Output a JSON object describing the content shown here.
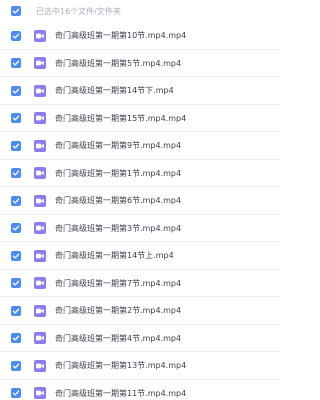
{
  "header": {
    "selection_text": "已选中16个文件/文件夹"
  },
  "files": [
    {
      "name": "奇门高级班第一期第10节.mp4.mp4"
    },
    {
      "name": "奇门高级班第一期第5节.mp4.mp4"
    },
    {
      "name": "奇门高级班第一期第14节下.mp4"
    },
    {
      "name": "奇门高级班第一期第15节.mp4.mp4"
    },
    {
      "name": "奇门高级班第一期第9节.mp4.mp4"
    },
    {
      "name": "奇门高级班第一期第1节.mp4.mp4"
    },
    {
      "name": "奇门高级班第一期第6节.mp4.mp4"
    },
    {
      "name": "奇门高级班第一期第3节.mp4.mp4"
    },
    {
      "name": "奇门高级班第一期第14节上.mp4"
    },
    {
      "name": "奇门高级班第一期第7节.mp4.mp4"
    },
    {
      "name": "奇门高级班第一期第2节.mp4.mp4"
    },
    {
      "name": "奇门高级班第一期第4节.mp4.mp4"
    },
    {
      "name": "奇门高级班第一期第13节.mp4.mp4"
    },
    {
      "name": "奇门高级班第一期第11节.mp4.mp4"
    }
  ],
  "icons": {
    "checkbox": "checkmark-icon",
    "file": "video-file-icon"
  },
  "colors": {
    "checkbox": "#4a8cf6",
    "video_icon": "#8c7cf0"
  }
}
